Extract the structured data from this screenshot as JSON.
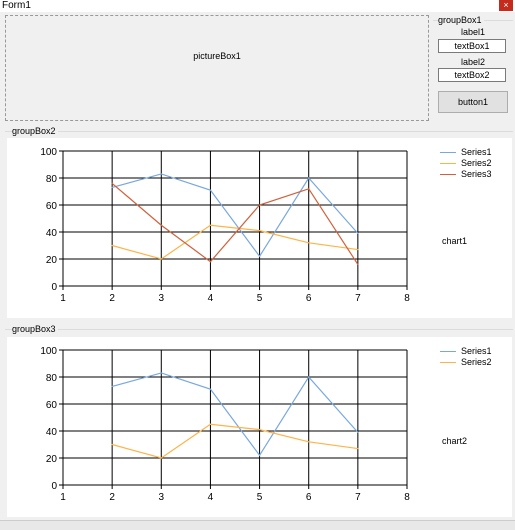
{
  "window": {
    "title": "Form1",
    "close_glyph": "×"
  },
  "picturebox": {
    "label": "pictureBox1"
  },
  "groupbox1": {
    "title": "groupBox1",
    "label1": "label1",
    "textbox1": "textBox1",
    "label2": "label2",
    "textbox2": "textBox2",
    "button1": "button1"
  },
  "groupbox2": {
    "title": "groupBox2",
    "chart_name": "chart1"
  },
  "groupbox3": {
    "title": "groupBox3",
    "chart_name": "chart2"
  },
  "colors": {
    "series1": "#78a8e0",
    "series2": "#ffb347",
    "series3": "#d2603a"
  },
  "chart_data": [
    {
      "type": "line",
      "title": "",
      "xlabel": "",
      "ylabel": "",
      "xlim": [
        1,
        8
      ],
      "ylim": [
        0,
        100
      ],
      "xticks": [
        1,
        2,
        3,
        4,
        5,
        6,
        7,
        8
      ],
      "yticks": [
        0,
        20,
        40,
        60,
        80,
        100
      ],
      "grid": true,
      "legend": "top-right",
      "x": [
        2,
        3,
        4,
        5,
        6,
        7
      ],
      "series": [
        {
          "name": "Series1",
          "values": [
            73,
            83,
            71,
            22,
            80,
            39
          ]
        },
        {
          "name": "Series2",
          "values": [
            30,
            20,
            45,
            41,
            32,
            27
          ]
        },
        {
          "name": "Series3",
          "values": [
            76,
            45,
            18,
            60,
            72,
            16
          ]
        }
      ]
    },
    {
      "type": "line",
      "title": "",
      "xlabel": "",
      "ylabel": "",
      "xlim": [
        1,
        8
      ],
      "ylim": [
        0,
        100
      ],
      "xticks": [
        1,
        2,
        3,
        4,
        5,
        6,
        7,
        8
      ],
      "yticks": [
        0,
        20,
        40,
        60,
        80,
        100
      ],
      "grid": true,
      "legend": "top-right",
      "x": [
        2,
        3,
        4,
        5,
        6,
        7
      ],
      "series": [
        {
          "name": "Series1",
          "values": [
            73,
            83,
            71,
            22,
            80,
            39
          ]
        },
        {
          "name": "Series2",
          "values": [
            30,
            20,
            45,
            41,
            32,
            27
          ]
        }
      ]
    }
  ]
}
